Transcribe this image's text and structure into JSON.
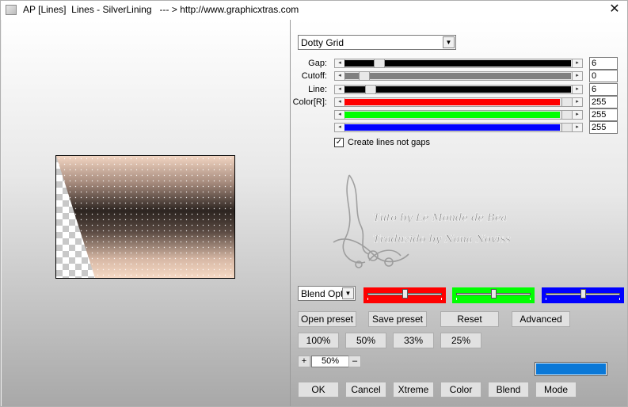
{
  "window": {
    "title": "AP [Lines]  Lines - SilverLining   --- > http://www.graphicxtras.com",
    "close_glyph": "✕"
  },
  "preset": {
    "value": "Dotty Grid",
    "arrow": "▼"
  },
  "params": {
    "gap": {
      "label": "Gap:",
      "value": "6",
      "fraction": 0.07,
      "fill": "#000000"
    },
    "cutoff": {
      "label": "Cutoff:",
      "value": "0",
      "fraction": 0.0,
      "fill": "#808080"
    },
    "line": {
      "label": "Line:",
      "value": "6",
      "fraction": 0.03,
      "fill": "#000000"
    },
    "color_r": {
      "label": "Color[R]:",
      "value": "255",
      "fraction": 1.0,
      "fill": "#ff0000"
    },
    "color_g": {
      "label": "",
      "value": "255",
      "fraction": 1.0,
      "fill": "#00ff00"
    },
    "color_b": {
      "label": "",
      "value": "255",
      "fraction": 1.0,
      "fill": "#0000ff"
    }
  },
  "slider_arrows": {
    "left": "◂",
    "right": "▸"
  },
  "checkbox": {
    "label": "Create lines not gaps",
    "checked": true,
    "mark": "✓"
  },
  "watermark": {
    "line1": "Tuto by Le Monde de Bea",
    "line2": "Traduzido by Nana Noviss"
  },
  "blend": {
    "value": "Blend Optio",
    "arrow": "▼",
    "red_level": 0.5,
    "green_level": 0.5,
    "blue_level": 0.5,
    "red_color": "#ff0000",
    "green_color": "#00ff00",
    "blue_color": "#0000ff"
  },
  "buttons": {
    "open_preset": "Open preset",
    "save_preset": "Save preset",
    "reset": "Reset",
    "advanced": "Advanced",
    "zoom_100": "100%",
    "zoom_50": "50%",
    "zoom_33": "33%",
    "zoom_25": "25%",
    "ok": "OK",
    "cancel": "Cancel",
    "xtreme": "Xtreme",
    "color": "Color",
    "blend": "Blend",
    "mode": "Mode"
  },
  "zoom": {
    "plus": "+",
    "minus": "–",
    "value": "50%"
  },
  "swatch_color": "#0a78d7"
}
